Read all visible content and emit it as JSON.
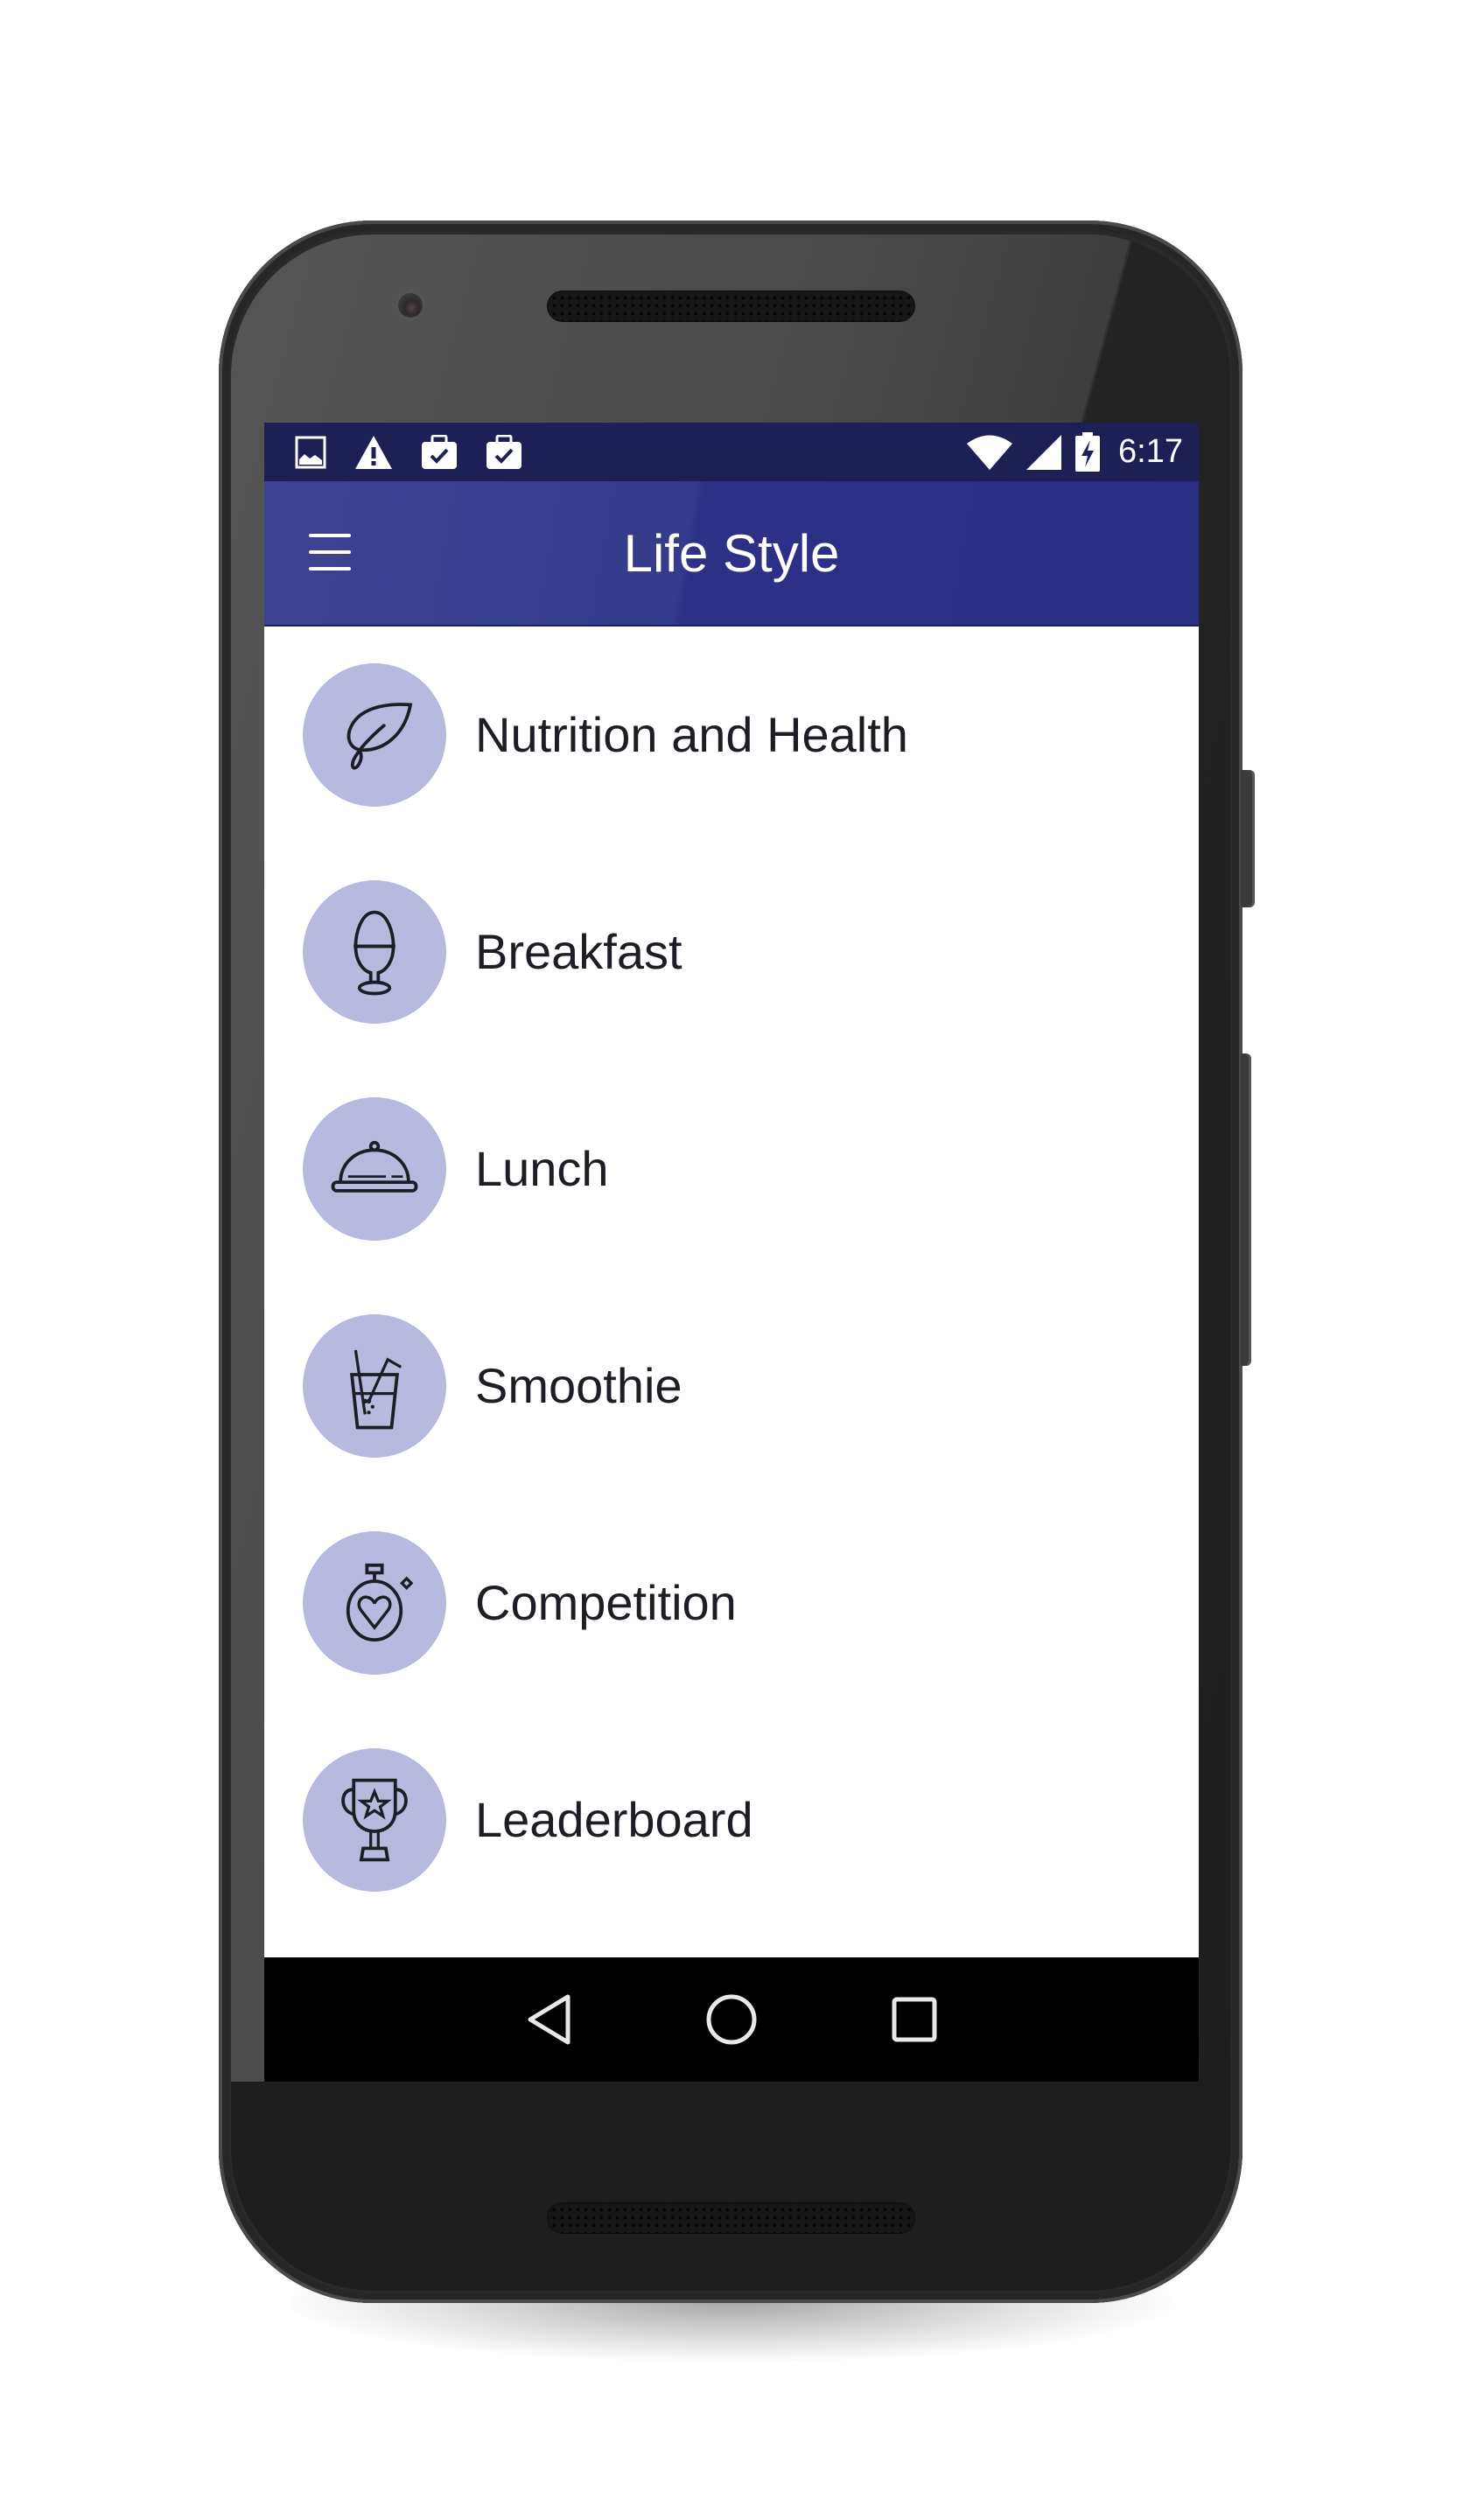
{
  "status_bar": {
    "left_icons": [
      "image-icon",
      "warning-icon",
      "briefcase-check-icon",
      "briefcase-check-icon"
    ],
    "right_icons": [
      "wifi-icon",
      "cell-signal-icon",
      "battery-charging-icon"
    ],
    "time": "6:17"
  },
  "app_bar": {
    "title": "Life Style",
    "menu_icon": "hamburger-menu-icon"
  },
  "colors": {
    "status_bar": "#1e1f55",
    "app_bar": "#2c3085",
    "icon_circle": "#b8b9df",
    "text": "#1c1e26",
    "nav_bar": "#000000"
  },
  "menu_items": [
    {
      "label": "Nutrition and Health",
      "icon": "leaf-icon"
    },
    {
      "label": "Breakfast",
      "icon": "egg-cup-icon"
    },
    {
      "label": "Lunch",
      "icon": "food-cloche-icon"
    },
    {
      "label": "Smoothie",
      "icon": "drink-straw-icon"
    },
    {
      "label": "Competition",
      "icon": "stopwatch-heart-icon"
    },
    {
      "label": "Leaderboard",
      "icon": "trophy-star-icon"
    }
  ],
  "nav_bar": {
    "buttons": [
      {
        "name": "back",
        "icon": "back-triangle-icon"
      },
      {
        "name": "home",
        "icon": "home-circle-icon"
      },
      {
        "name": "recents",
        "icon": "recents-square-icon"
      }
    ]
  }
}
